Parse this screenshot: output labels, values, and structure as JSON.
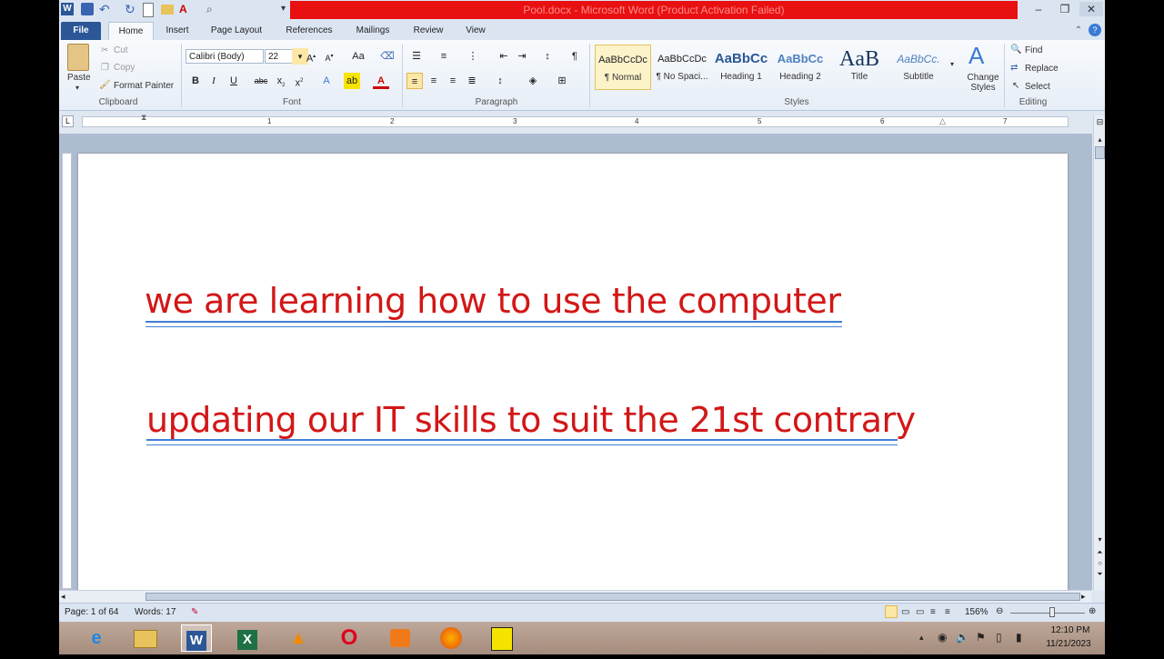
{
  "window": {
    "title": "Pool.docx - Microsoft Word (Product Activation Failed)",
    "minimize": "–",
    "restore": "❐",
    "close": "✕"
  },
  "tabs": [
    "File",
    "Home",
    "Insert",
    "Page Layout",
    "References",
    "Mailings",
    "Review",
    "View"
  ],
  "clipboard": {
    "paste": "Paste",
    "cut": "Cut",
    "copy": "Copy",
    "format_painter": "Format Painter",
    "label": "Clipboard"
  },
  "font": {
    "name": "Calibri (Body)",
    "size": "22",
    "label": "Font",
    "change_case": "Aa"
  },
  "paragraph": {
    "label": "Paragraph"
  },
  "styles": {
    "label": "Styles",
    "items": [
      {
        "preview": "AaBbCcDc",
        "name": "¶ Normal"
      },
      {
        "preview": "AaBbCcDc",
        "name": "¶ No Spaci..."
      },
      {
        "preview": "AaBbCc",
        "name": "Heading 1"
      },
      {
        "preview": "AaBbCc",
        "name": "Heading 2"
      },
      {
        "preview": "AaB",
        "name": "Title"
      },
      {
        "preview": "AaBbCc.",
        "name": "Subtitle"
      }
    ],
    "change_styles": "Change Styles"
  },
  "editing": {
    "find": "Find",
    "replace": "Replace",
    "select": "Select",
    "label": "Editing"
  },
  "ruler": {
    "numbers": [
      "1",
      "2",
      "3",
      "4",
      "5",
      "6",
      "7"
    ]
  },
  "document": {
    "line1": " we are learning how to use the computer",
    "line2": "updating our IT skills to suit the 21st contrary"
  },
  "status": {
    "page": "Page: 1 of 64",
    "words": "Words: 17",
    "zoom": "156%",
    "zoom_level": 0.56
  },
  "taskbar": {
    "time": "12:10 PM",
    "date": "11/21/2023",
    "apps": [
      "internet-explorer",
      "file-explorer",
      "word",
      "excel",
      "vlc",
      "opera",
      "media-player",
      "firefox",
      "notepad"
    ]
  },
  "colors": {
    "text_red": "#d21717",
    "title_bar": "#e81010",
    "file_tab": "#2b5797"
  }
}
